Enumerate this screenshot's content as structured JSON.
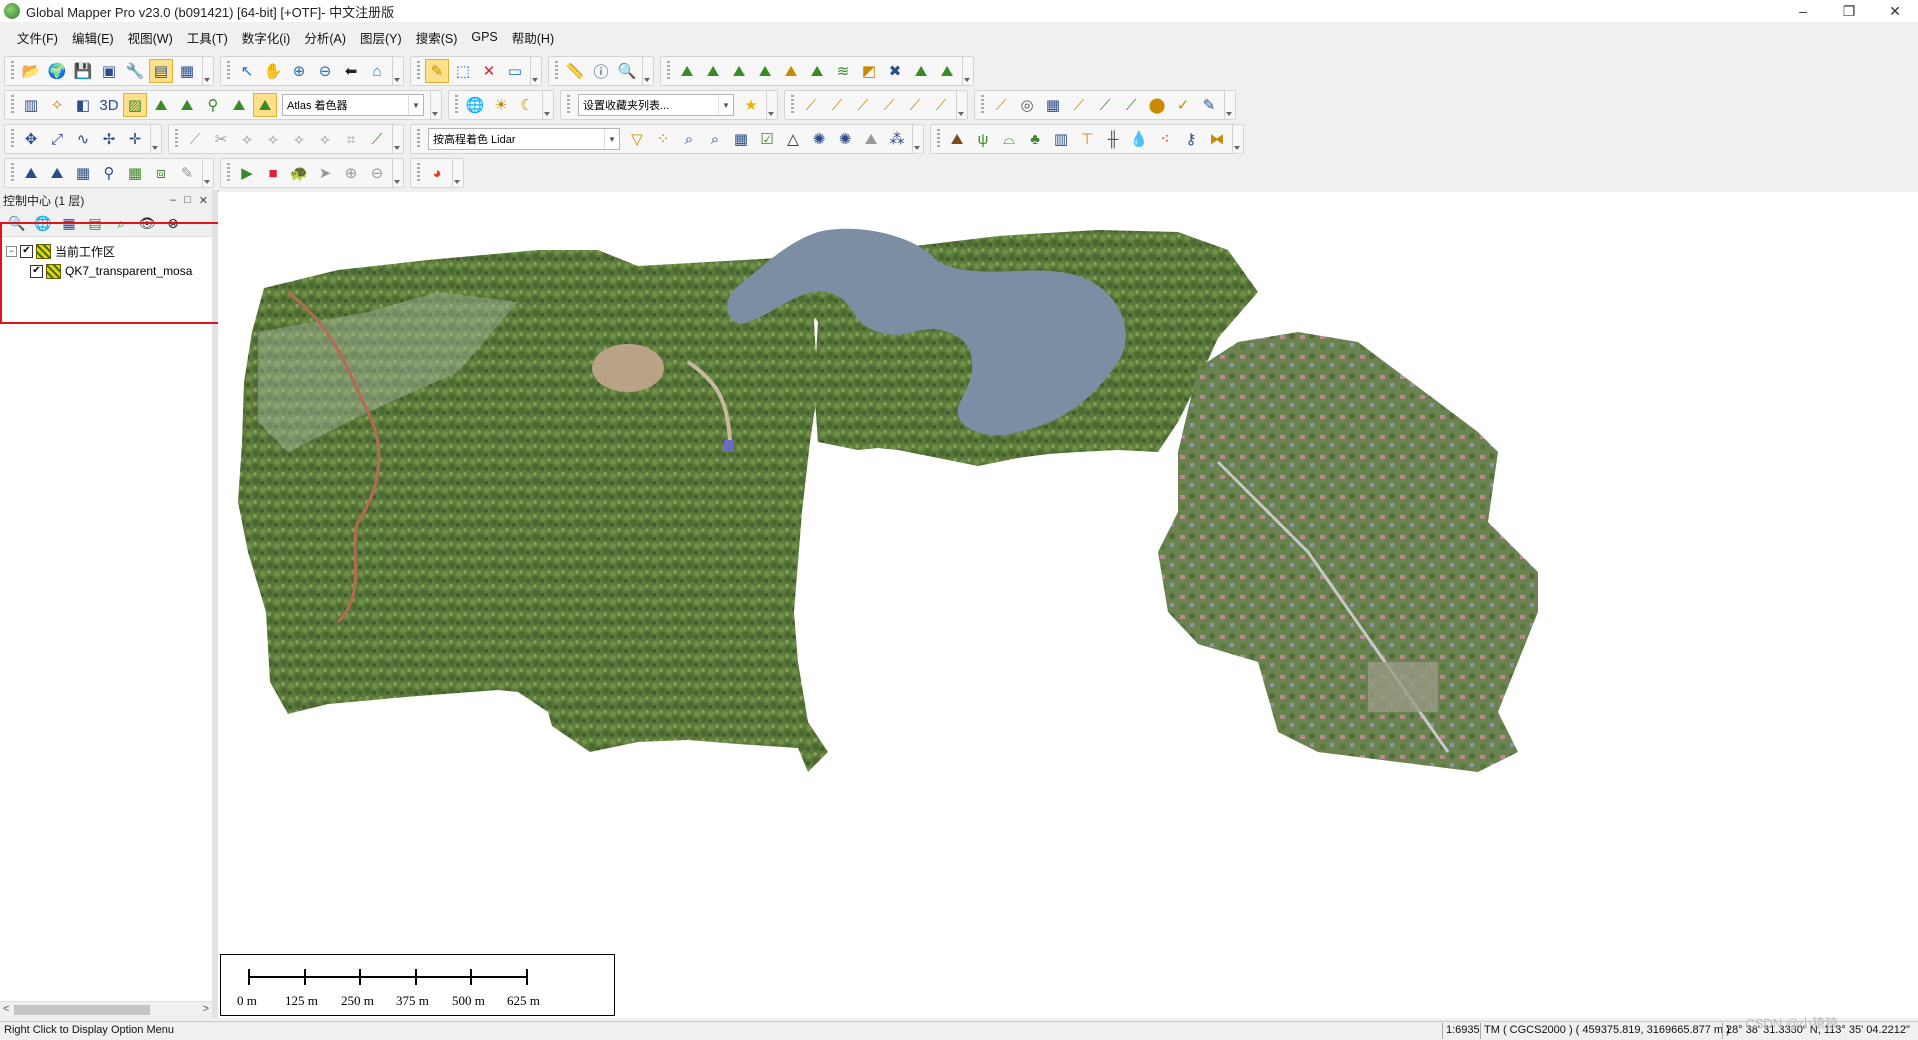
{
  "window": {
    "title": "Global Mapper Pro v23.0 (b091421) [64-bit] [+OTF]- 中文注册版",
    "minimize": "–",
    "maximize": "❐",
    "close": "✕"
  },
  "menu": [
    {
      "label": "文件(F)"
    },
    {
      "label": "编辑(E)"
    },
    {
      "label": "视图(W)"
    },
    {
      "label": "工具(T)"
    },
    {
      "label": "数字化(i)"
    },
    {
      "label": "分析(A)"
    },
    {
      "label": "图层(Y)"
    },
    {
      "label": "搜索(S)"
    },
    {
      "label": "GPS"
    },
    {
      "label": "帮助(H)"
    }
  ],
  "toolbars": {
    "atlas_shader": "Atlas 着色器",
    "bookmarks": "设置收藏夹列表...",
    "lidar_color": "按高程着色 Lidar"
  },
  "control_center": {
    "title": "控制中心 (1 层)",
    "tree": {
      "root": "当前工作区",
      "layer": "QK7_transparent_mosa"
    },
    "scroll_left": "<",
    "scroll_right": ">"
  },
  "scalebar": {
    "labels": [
      "0 m",
      "125 m",
      "250 m",
      "375 m",
      "500 m",
      "625 m"
    ]
  },
  "status": {
    "hint": "Right Click to Display Option Menu",
    "scale": "1:6935",
    "projection": "TM ( CGCS2000 ) ( 459375.819, 3169665.877 m )",
    "latlon": "28° 38' 31.3330\" N, 113° 35' 04.2212\""
  },
  "watermark": "CSDN @小猿猿",
  "colors": {
    "highlight": "#e0141e",
    "vegetation": "#5f7f3f",
    "water": "#7c8ea3"
  }
}
